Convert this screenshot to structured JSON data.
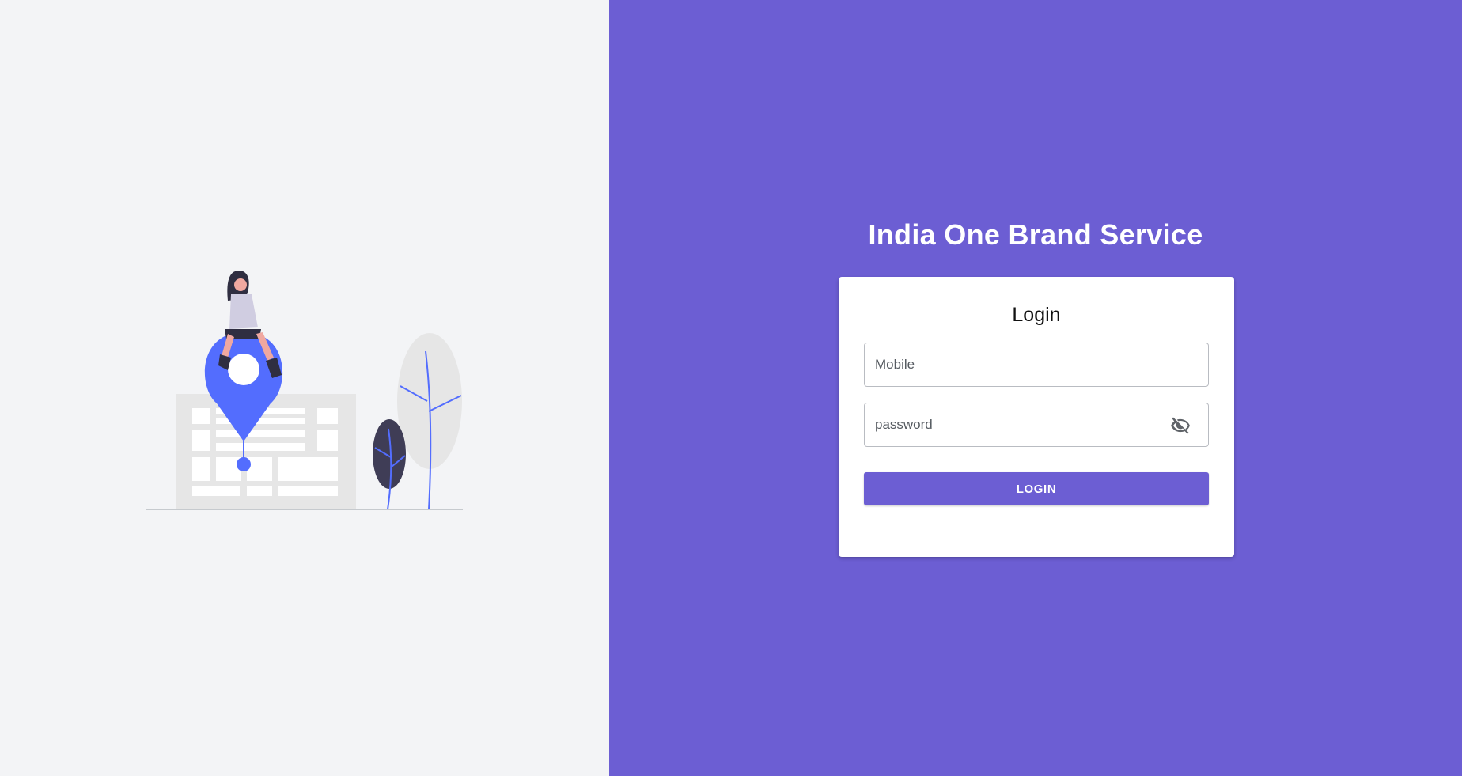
{
  "colors": {
    "left_background": "#f3f4f6",
    "right_background": "#6c5ed3",
    "accent": "#6c5ed3",
    "pin_blue": "#536dfe"
  },
  "app": {
    "title": "India One Brand Service"
  },
  "login_form": {
    "title": "Login",
    "mobile": {
      "value": "",
      "placeholder": "Mobile"
    },
    "password": {
      "value": "",
      "placeholder": "password",
      "toggle_icon": "eye-off-icon"
    },
    "submit_label": "LOGIN"
  },
  "illustration": {
    "icon": "location-pin-woman-illustration"
  }
}
